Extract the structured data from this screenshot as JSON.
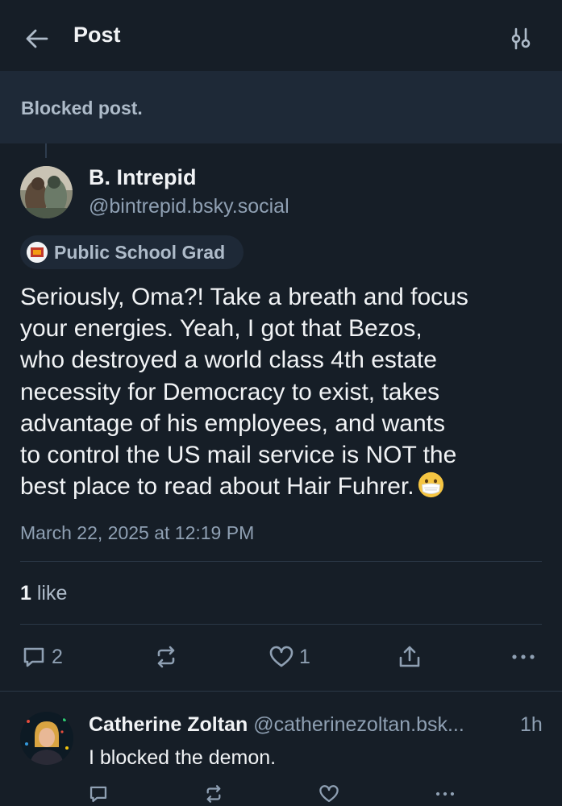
{
  "header": {
    "title": "Post",
    "back_icon": "arrow-left-icon",
    "filter_icon": "sliders-icon"
  },
  "blocked": {
    "text": "Blocked post."
  },
  "post": {
    "author_name": "B. Intrepid",
    "author_handle": "@bintrepid.bsky.social",
    "badge_label": "Public School Grad",
    "body_lines": [
      "Seriously, Oma?! Take a breath and focus",
      "your energies. Yeah, I got that Bezos,",
      "who destroyed a world class 4th estate",
      "necessity for Democracy to exist, takes",
      "advantage of his employees, and wants",
      "to control the US mail service is NOT the",
      "best place to read about Hair Fuhrer."
    ],
    "emoji": "mask-face-emoji",
    "timestamp": "March 22, 2025 at 12:19 PM",
    "likes_count": "1",
    "likes_label": " like",
    "actions": {
      "reply_count": "2",
      "repost_count": "",
      "like_count": "1"
    }
  },
  "reply": {
    "author_name": "Catherine Zoltan",
    "author_handle": "@catherinezoltan.bsk...",
    "time": "1h",
    "text": "I blocked the demon."
  },
  "colors": {
    "background": "#161e27",
    "panel": "#1e2937",
    "text_primary": "#f1f3f5",
    "text_secondary": "#8fa0b3",
    "divider": "#2b3847"
  }
}
